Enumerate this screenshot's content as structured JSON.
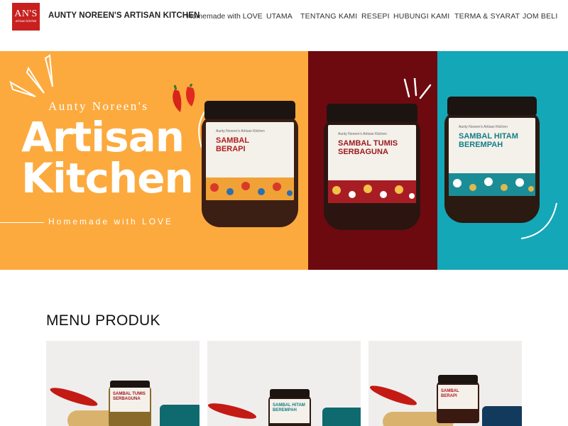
{
  "header": {
    "logo_text": "AN'S",
    "logo_sub": "artisan kitchen",
    "brand": "AUNTY NOREEN'S ARTISAN KITCHEN",
    "tagline": "Homemade with LOVE",
    "nav": [
      "UTAMA",
      "TENTANG KAMI",
      "RESEPI",
      "HUBUNGI KAMI",
      "TERMA & SYARAT",
      "JOM BELI"
    ]
  },
  "hero": {
    "pre_title": "Aunty Noreen's",
    "title_line1": "Artisan",
    "title_line2": "Kitchen",
    "tagline": "Homemade with LOVE",
    "jars": [
      {
        "brand": "Aunty Noreen's Artisan Kitchen",
        "name_line1": "SAMBAL",
        "name_line2": "BERAPI",
        "name_color": "#b11d1f"
      },
      {
        "brand": "Aunty Noreen's Artisan Kitchen",
        "name_line1": "SAMBAL TUMIS",
        "name_line2": "SERBAGUNA",
        "name_color": "#9e1a20"
      },
      {
        "brand": "Aunty Noreen's Artisan Kitchen",
        "name_line1": "SAMBAL HITAM",
        "name_line2": "BEREMPAH",
        "name_color": "#157e88"
      }
    ],
    "colors": {
      "orange": "#fcaa3e",
      "maroon": "#6c0a10",
      "teal": "#14a7b7"
    }
  },
  "menu": {
    "title": "MENU PRODUK",
    "products": [
      {
        "label_line1": "SAMBAL TUMIS",
        "label_line2": "SERBAGUNA"
      },
      {
        "label_line1": "SAMBAL HITAM",
        "label_line2": "BEREMPAH"
      },
      {
        "label_line1": "SAMBAL",
        "label_line2": "BERAPI"
      }
    ]
  }
}
